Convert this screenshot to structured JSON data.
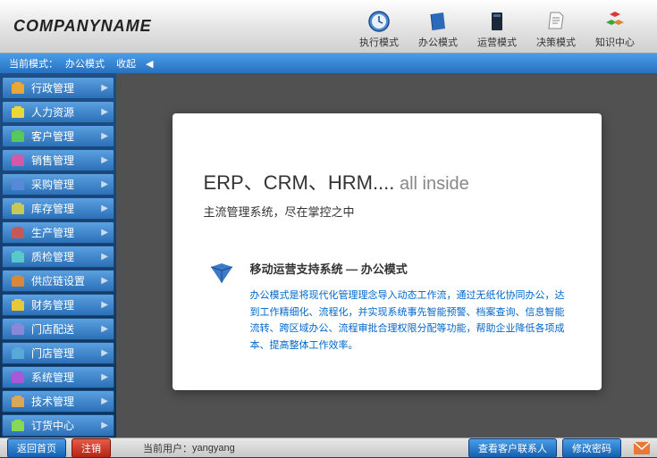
{
  "logo": "COMPANYNAME",
  "top_nav": [
    {
      "label": "执行模式",
      "icon": "clock"
    },
    {
      "label": "办公模式",
      "icon": "book-blue"
    },
    {
      "label": "运营模式",
      "icon": "book-dark"
    },
    {
      "label": "决策模式",
      "icon": "paper"
    },
    {
      "label": "知识中心",
      "icon": "cubes"
    }
  ],
  "mode_bar": {
    "label": "当前模式：",
    "value": "办公模式",
    "collapse": "收起"
  },
  "sidebar": {
    "items": [
      {
        "label": "行政管理"
      },
      {
        "label": "人力资源"
      },
      {
        "label": "客户管理"
      },
      {
        "label": "销售管理"
      },
      {
        "label": "采购管理"
      },
      {
        "label": "库存管理"
      },
      {
        "label": "生产管理"
      },
      {
        "label": "质检管理"
      },
      {
        "label": "供应链设置"
      },
      {
        "label": "财务管理"
      },
      {
        "label": "门店配送"
      },
      {
        "label": "门店管理"
      },
      {
        "label": "系统管理"
      },
      {
        "label": "技术管理"
      },
      {
        "label": "订货中心"
      }
    ]
  },
  "card": {
    "title_main": "ERP、CRM、HRM....",
    "title_suffix": " all inside",
    "subtitle": "主流管理系统，尽在掌控之中",
    "heading": "移动运营支持系统 — 办公模式",
    "desc": "办公模式是将现代化管理理念导入动态工作流，通过无纸化协同办公，达到工作精细化、流程化，并实现系统事先智能预警、档案查询、信息智能流转、跨区域办公、流程审批合理权限分配等功能，帮助企业降低各项成本、提高整体工作效率。"
  },
  "footer": {
    "home": "返回首页",
    "logout": "注销",
    "user_label": "当前用户：",
    "user_value": "yangyang",
    "contact": "查看客户联系人",
    "change_pwd": "修改密码"
  }
}
